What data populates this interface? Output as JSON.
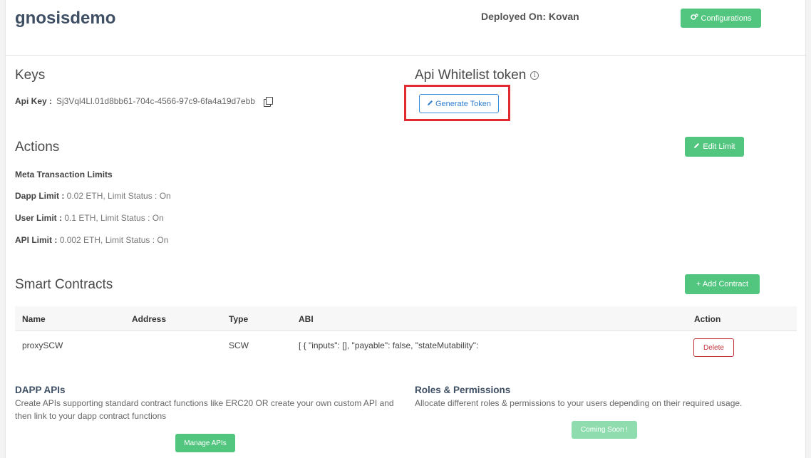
{
  "header": {
    "title": "gnosisdemo",
    "deployed_label": "Deployed On:",
    "deployed_value": "Kovan",
    "config_button": "Configurations"
  },
  "keys": {
    "title": "Keys",
    "api_key_label": "Api Key :",
    "api_key_value": "Sj3Vql4Ll.01d8bb61-704c-4566-97c9-6fa4a19d7ebb"
  },
  "whitelist": {
    "title": "Api Whitelist token",
    "info_glyph": "i",
    "generate_button": "Generate Token"
  },
  "actions": {
    "title": "Actions",
    "edit_button": "Edit Limit",
    "meta_title": "Meta Transaction Limits",
    "limits": [
      {
        "label": "Dapp Limit :",
        "value": "0.02 ETH, Limit Status : On"
      },
      {
        "label": "User Limit :",
        "value": "0.1 ETH, Limit Status : On"
      },
      {
        "label": "API Limit :",
        "value": "0.002 ETH, Limit Status : On"
      }
    ]
  },
  "contracts": {
    "title": "Smart Contracts",
    "add_button": "+ Add Contract",
    "columns": [
      "Name",
      "Address",
      "Type",
      "ABI",
      "Action"
    ],
    "rows": [
      {
        "name": "proxySCW",
        "address": "",
        "type": "SCW",
        "abi": "[ { \"inputs\": [], \"payable\": false, \"stateMutability\":",
        "action": "Delete"
      }
    ]
  },
  "dapp_apis": {
    "title": "DAPP APIs",
    "description": "Create APIs supporting standard contract functions like ERC20 OR create your own custom API and then link to your dapp contract functions",
    "button": "Manage APIs"
  },
  "roles": {
    "title": "Roles & Permissions",
    "description": "Allocate different roles & permissions to your users depending on their required usage.",
    "button": "Coming Soon !"
  },
  "colors": {
    "accent_green": "#52c67f",
    "highlight_red": "#e02b33",
    "link_blue": "#2f7fd1",
    "danger": "#c0343c"
  }
}
